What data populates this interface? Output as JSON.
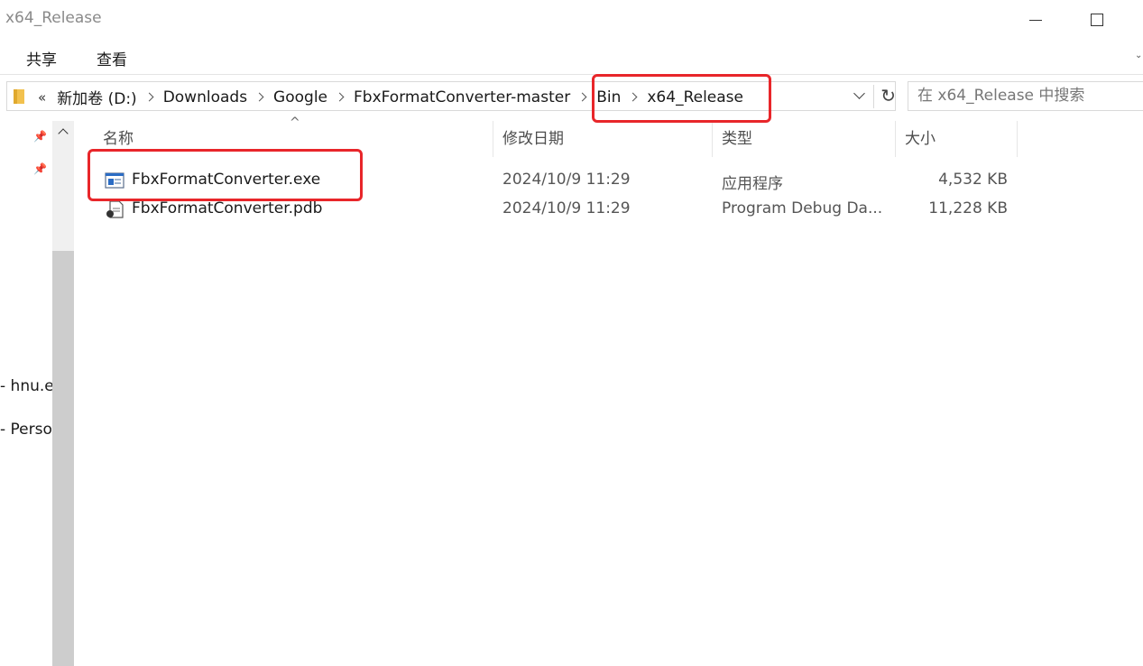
{
  "window": {
    "title": "x64_Release"
  },
  "ribbon": {
    "tabs": [
      "共享",
      "查看"
    ]
  },
  "address": {
    "overflow": "«",
    "crumbs": [
      "新加卷 (D:)",
      "Downloads",
      "Google",
      "FbxFormatConverter-master",
      "Bin",
      "x64_Release"
    ]
  },
  "search": {
    "placeholder": "在 x64_Release 中搜索"
  },
  "nav": {
    "items": [
      "- hnu.e",
      "- Perso"
    ]
  },
  "columns": {
    "name": "名称",
    "date": "修改日期",
    "type": "类型",
    "size": "大小"
  },
  "files": [
    {
      "name": "FbxFormatConverter.exe",
      "date": "2024/10/9 11:29",
      "type": "应用程序",
      "size": "4,532 KB",
      "icon": "exe-icon"
    },
    {
      "name": "FbxFormatConverter.pdb",
      "date": "2024/10/9 11:29",
      "type": "Program Debug Da...",
      "size": "11,228 KB",
      "icon": "pdb-file-icon"
    }
  ],
  "colors": {
    "annotation": "#e8262a",
    "scroll_thumb": "#cdcdcd"
  }
}
